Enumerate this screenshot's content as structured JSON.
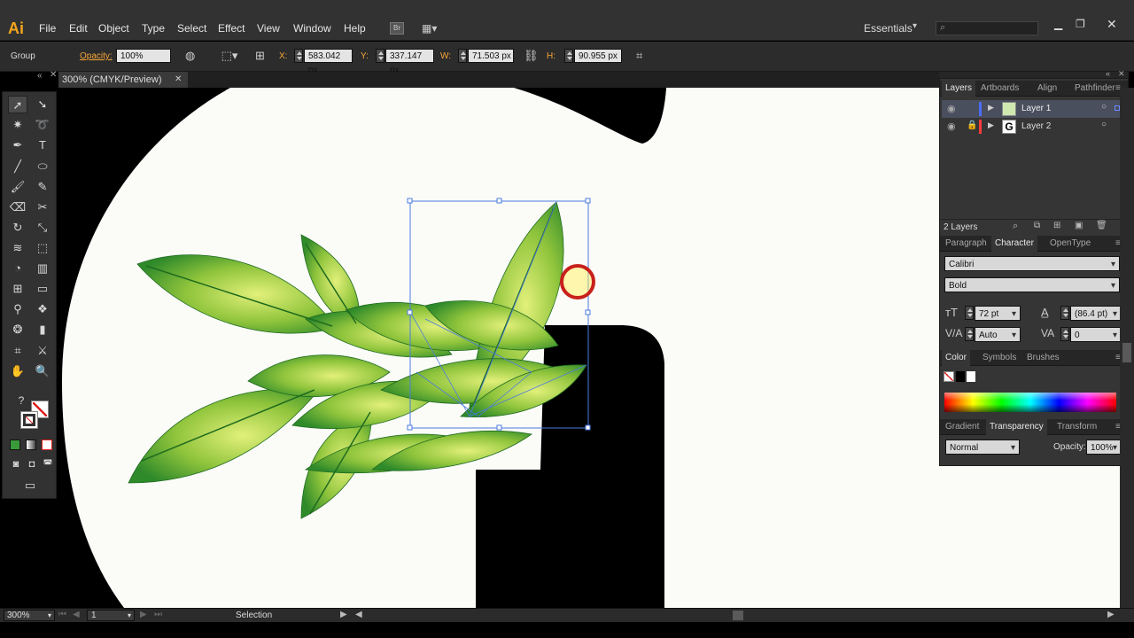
{
  "app": {
    "logo": "Ai"
  },
  "menu": [
    "File",
    "Edit",
    "Object",
    "Type",
    "Select",
    "Effect",
    "View",
    "Window",
    "Help"
  ],
  "workspace": {
    "label": "Essentials"
  },
  "search": {
    "placeholder": ""
  },
  "control_bar": {
    "selection_type": "Group",
    "opacity_label": "Opacity:",
    "opacity_value": "100%",
    "x_label": "X:",
    "x_value": "583.042 px",
    "y_label": "Y:",
    "y_value": "337.147 px",
    "w_label": "W:",
    "w_value": "71.503 px",
    "h_label": "H:",
    "h_value": "90.955 px"
  },
  "document_tab": {
    "title": "300% (CMYK/Preview)"
  },
  "layers_panel": {
    "tabs": [
      "Layers",
      "Artboards",
      "Align",
      "Pathfinder"
    ],
    "layers": [
      {
        "name": "Layer 1",
        "color": "#4b6cff"
      },
      {
        "name": "Layer 2",
        "color": "#ff3b3b"
      }
    ],
    "count": "2 Layers"
  },
  "character_panel": {
    "tabs": [
      "Paragraph",
      "Character",
      "OpenType"
    ],
    "font_family": "Calibri",
    "font_style": "Bold",
    "font_size": "72 pt",
    "leading": "(86.4 pt)",
    "kerning": "Auto",
    "tracking": "0"
  },
  "color_panel": {
    "tabs": [
      "Color",
      "Symbols",
      "Brushes"
    ]
  },
  "transparency_panel": {
    "tabs": [
      "Gradient",
      "Transparency",
      "Transform"
    ],
    "blend_mode": "Normal",
    "opacity_label": "Opacity:",
    "opacity_value": "100%"
  },
  "status_bar": {
    "zoom": "300%",
    "artboard": "1",
    "tool": "Selection"
  }
}
